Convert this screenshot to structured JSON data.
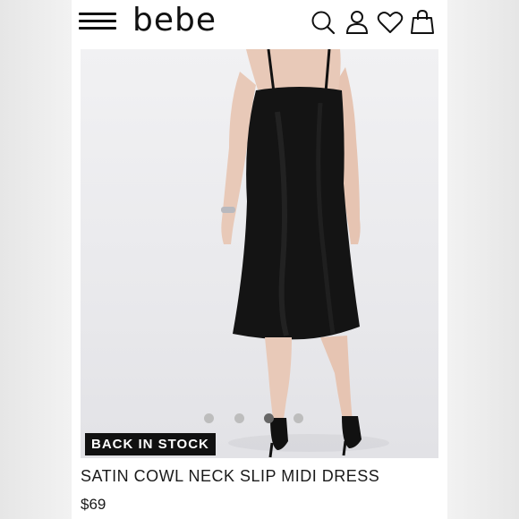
{
  "header": {
    "brand": "bebe",
    "icons": [
      "menu-icon",
      "search-icon",
      "account-icon",
      "heart-icon",
      "bag-icon"
    ]
  },
  "product": {
    "badge": "BACK IN STOCK",
    "name": "SATIN COWL NECK SLIP MIDI DRESS",
    "price": "$69",
    "image_count": 4,
    "active_image": 3
  },
  "colors": {
    "badge_bg": "#111111",
    "badge_text": "#ffffff",
    "text": "#1a1a1a",
    "dress": "#111111"
  }
}
